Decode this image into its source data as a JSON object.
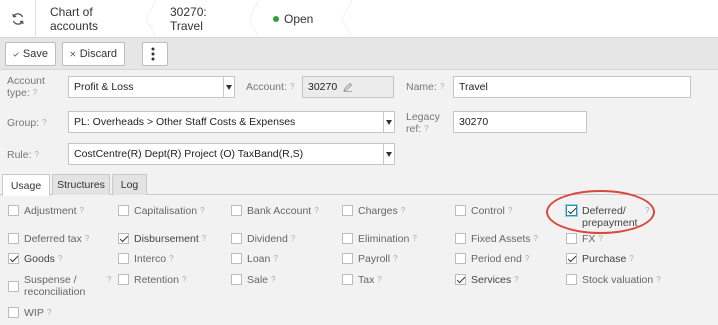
{
  "breadcrumb": {
    "items": [
      "Chart of accounts",
      "30270: Travel",
      "Open"
    ],
    "status_color": "#2e9e3e"
  },
  "toolbar": {
    "save_label": "Save",
    "discard_label": "Discard",
    "more_icon": "vertical-ellipsis-icon",
    "refresh_icon": "refresh-icon"
  },
  "form": {
    "account_type_label": "Account type:",
    "account_type_value": "Profit & Loss",
    "account_label": "Account:",
    "account_value": "30270",
    "name_label": "Name:",
    "name_value": "Travel",
    "group_label": "Group:",
    "group_value": "PL: Overheads > Other Staff Costs & Expenses",
    "legacy_ref_label": "Legacy ref:",
    "legacy_ref_value": "30270",
    "rule_label": "Rule:",
    "rule_value": "CostCentre(R) Dept(R) Project (O) TaxBand(R,S)",
    "help_mark": "?"
  },
  "tabs": [
    "Usage",
    "Structures",
    "Log"
  ],
  "usage": [
    {
      "label": "Adjustment",
      "checked": false
    },
    {
      "label": "Capitalisation",
      "checked": false
    },
    {
      "label": "Bank Account",
      "checked": false
    },
    {
      "label": "Charges",
      "checked": false
    },
    {
      "label": "Control",
      "checked": false
    },
    {
      "label": "Deferred/ prepayment",
      "checked": true
    },
    {
      "label": "Deferred tax",
      "checked": false
    },
    {
      "label": "Disbursement",
      "checked": true
    },
    {
      "label": "Dividend",
      "checked": false
    },
    {
      "label": "Elimination",
      "checked": false
    },
    {
      "label": "Fixed Assets",
      "checked": false
    },
    {
      "label": "FX",
      "checked": false
    },
    {
      "label": "Goods",
      "checked": true
    },
    {
      "label": "Interco",
      "checked": false
    },
    {
      "label": "Loan",
      "checked": false
    },
    {
      "label": "Payroll",
      "checked": false
    },
    {
      "label": "Period end",
      "checked": false
    },
    {
      "label": "Purchase",
      "checked": true
    },
    {
      "label": "Suspense / reconciliation",
      "checked": false
    },
    {
      "label": "Retention",
      "checked": false
    },
    {
      "label": "Sale",
      "checked": false
    },
    {
      "label": "Tax",
      "checked": false
    },
    {
      "label": "Services",
      "checked": true
    },
    {
      "label": "Stock valuation",
      "checked": false
    },
    {
      "label": "WIP",
      "checked": false
    }
  ],
  "highlight_color": "#d9473f"
}
